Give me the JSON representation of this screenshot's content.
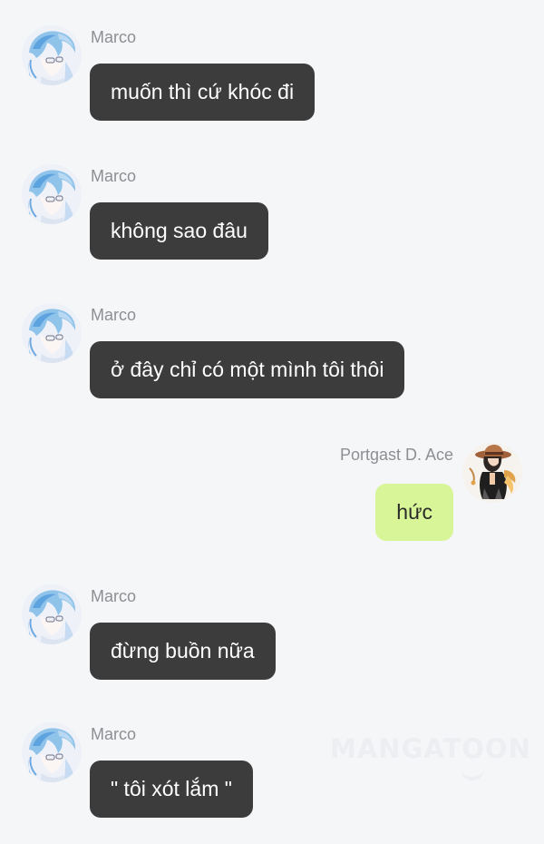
{
  "watermark": "MANGATOON",
  "colors": {
    "background": "#f5f6f8",
    "incoming_bubble": "#3c3c3c",
    "outgoing_bubble": "#d8f598",
    "sender_name": "#8e8e93"
  },
  "messages": [
    {
      "side": "left",
      "sender": "Marco",
      "text": "muốn thì cứ khóc đi",
      "avatar": "marco-avatar"
    },
    {
      "side": "left",
      "sender": "Marco",
      "text": "không sao đâu",
      "avatar": "marco-avatar"
    },
    {
      "side": "left",
      "sender": "Marco",
      "text": "ở đây chỉ có một mình tôi thôi",
      "avatar": "marco-avatar"
    },
    {
      "side": "right",
      "sender": "Portgast D. Ace",
      "text": "hức",
      "avatar": "ace-avatar"
    },
    {
      "side": "left",
      "sender": "Marco",
      "text": "đừng buồn nữa",
      "avatar": "marco-avatar"
    },
    {
      "side": "left",
      "sender": "Marco",
      "text": "\" tôi xót lắm \"",
      "avatar": "marco-avatar"
    }
  ]
}
